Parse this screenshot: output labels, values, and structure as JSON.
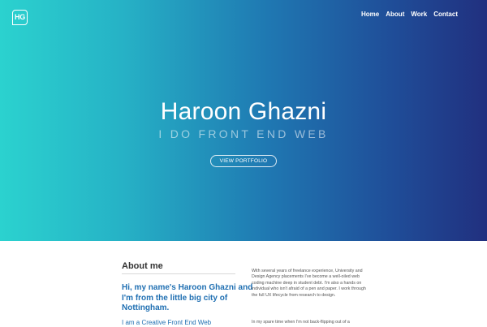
{
  "header": {
    "logo_text": "HG",
    "nav": [
      "Home",
      "About",
      "Work",
      "Contact"
    ]
  },
  "hero": {
    "title": "Haroon Ghazni",
    "subtitle": "I DO FRONT END WEB",
    "cta_label": "VIEW PORTFOLIO",
    "gradient_colors": [
      "#2bd2cf",
      "#1f78b2",
      "#21307f"
    ]
  },
  "about": {
    "heading": "About me",
    "intro": "Hi, my name's Haroon Ghazni and I'm from the little big city of Nottingham.",
    "more": "I am a Creative Front End Web",
    "paragraph1": "With several years of freelance experience, University and Design Agency placements I've become a well-oiled web coding machine deep in student debt. I'm also a hands on individual who isn't afraid of a pen and paper. I work through the full UX lifecycle from research to design.",
    "paragraph2": "In my spare time when I'm not back-flipping out of a",
    "accent_color": "#1f6fb2"
  }
}
